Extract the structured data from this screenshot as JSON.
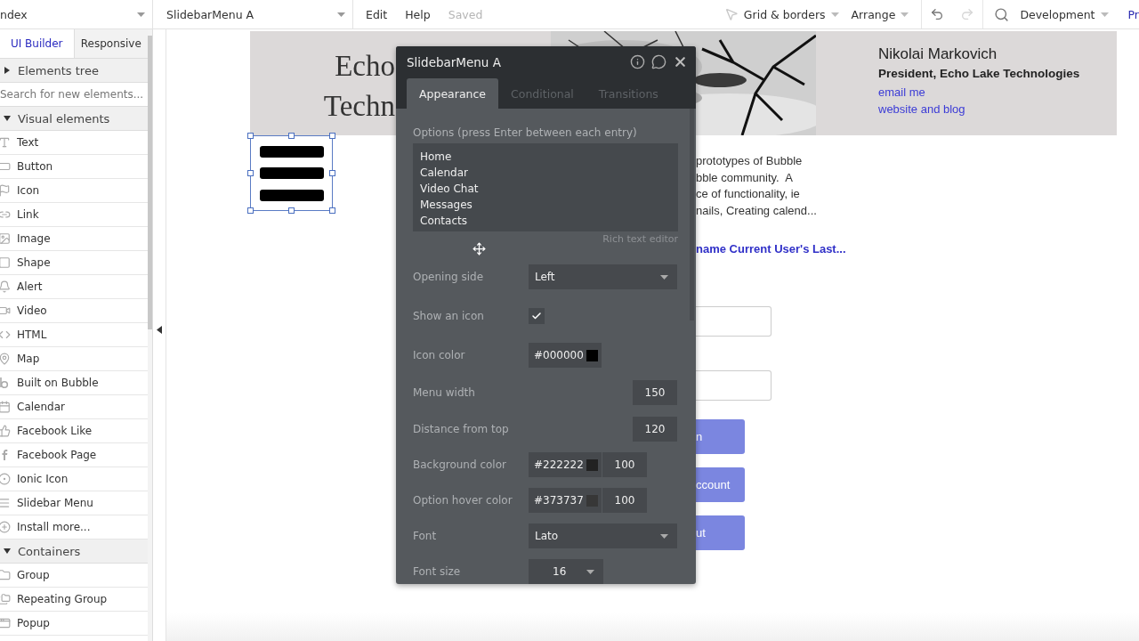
{
  "top_bar": {
    "page_selector": "ndex",
    "element_selector": "SlidebarMenu A",
    "menu": [
      {
        "label": "Edit",
        "disabled": false
      },
      {
        "label": "Help",
        "disabled": false
      },
      {
        "label": "Saved",
        "disabled": true
      }
    ],
    "tools": [
      {
        "label": "Grid & borders"
      },
      {
        "label": "Arrange"
      }
    ],
    "redo_disabled": true,
    "version": "Development",
    "cut_link": "Pr"
  },
  "sidebar": {
    "tabs": [
      {
        "label": "UI Builder",
        "selected": true
      },
      {
        "label": "Responsive",
        "selected": false
      }
    ],
    "tree_header": {
      "label": "Elements tree",
      "expanded": false
    },
    "search": {
      "placeholder": "Search for new elements..."
    },
    "groups": [
      {
        "label": "Visual elements",
        "expanded": true,
        "items": [
          "Text",
          "Button",
          "Icon",
          "Link",
          "Image",
          "Shape",
          "Alert",
          "Video",
          "HTML",
          "Map",
          "Built on Bubble",
          "Calendar",
          "Facebook Like",
          "Facebook Page",
          "Ionic Icon",
          "Slidebar Menu",
          "Install more..."
        ]
      },
      {
        "label": "Containers",
        "expanded": true,
        "items": [
          "Group",
          "Repeating Group",
          "Popup"
        ]
      }
    ]
  },
  "canvas": {
    "header": {
      "title_lines": [
        "Echo",
        "Techn"
      ],
      "profile": {
        "name": "Nikolai Markovich",
        "role": "President, Echo Lake Technologies",
        "links": [
          "email me",
          "website and blog"
        ]
      }
    },
    "body_lines": [
      "prototypes of Bubble",
      "bble community.  A",
      "ce of functionality, ie",
      "nails, Creating calend..."
    ],
    "link": "name Current User's Last...",
    "buttons": [
      "n",
      "ccount",
      "ut"
    ]
  },
  "panel": {
    "title": "SlidebarMenu A",
    "tabs": [
      {
        "label": "Appearance",
        "selected": true
      },
      {
        "label": "Conditional",
        "selected": false
      },
      {
        "label": "Transitions",
        "selected": false
      }
    ],
    "options_label": "Options (press Enter between each entry)",
    "options": [
      "Home",
      "Calendar",
      "Video Chat",
      "Messages",
      "Contacts"
    ],
    "rich_text_link": "Rich text editor",
    "properties": [
      {
        "kind": "dropdown",
        "label": "Opening side",
        "value": "Left"
      },
      {
        "kind": "checkbox",
        "label": "Show an icon",
        "checked": true
      },
      {
        "kind": "color",
        "label": "Icon color",
        "value": "#000000",
        "color": "#000000"
      },
      {
        "kind": "number",
        "label": "Menu width",
        "value": "150"
      },
      {
        "kind": "number",
        "label": "Distance from top",
        "value": "120"
      },
      {
        "kind": "color_opacity",
        "label": "Background color",
        "value": "#222222",
        "color": "#222222",
        "opacity": "100"
      },
      {
        "kind": "color_opacity",
        "label": "Option hover color",
        "value": "#373737",
        "color": "#373737",
        "opacity": "100"
      },
      {
        "kind": "dropdown",
        "label": "Font",
        "value": "Lato"
      },
      {
        "kind": "small_dropdown",
        "label": "Font size",
        "value": "16"
      }
    ]
  }
}
